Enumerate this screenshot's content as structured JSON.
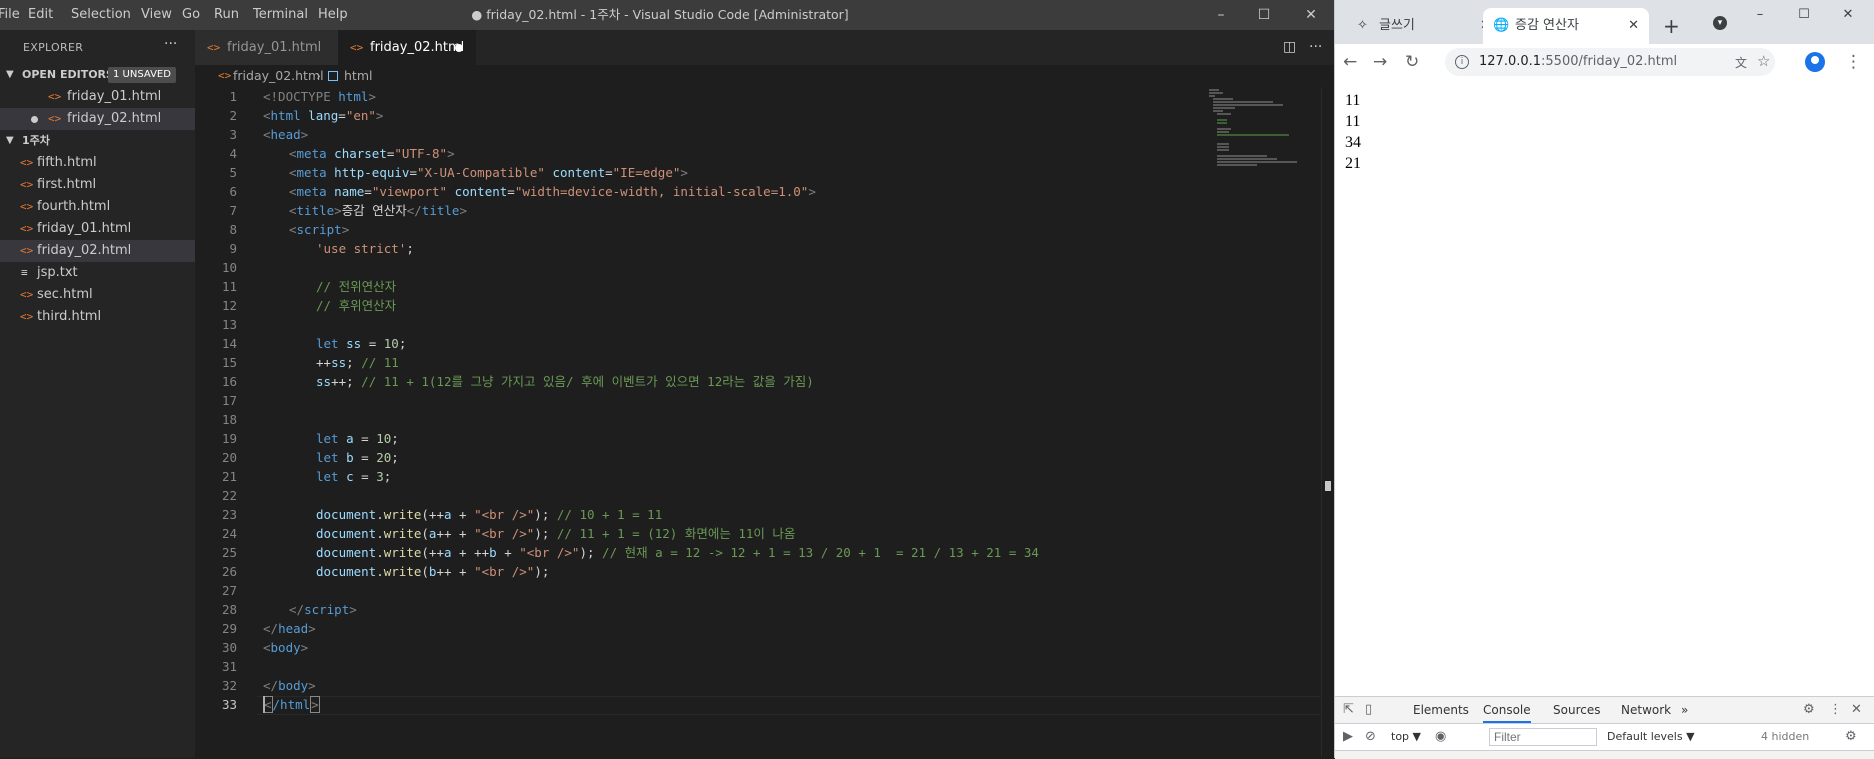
{
  "vscode": {
    "menu": [
      "File",
      "Edit",
      "Selection",
      "View",
      "Go",
      "Run",
      "Terminal",
      "Help"
    ],
    "window_title": "● friday_02.html - 1주차 - Visual Studio Code [Administrator]",
    "explorer_title": "EXPLORER",
    "open_editors": {
      "label": "OPEN EDITORS",
      "badge": "1 UNSAVED",
      "files": [
        "friday_01.html",
        "friday_02.html"
      ]
    },
    "folder": {
      "label": "1주차",
      "files": [
        "fifth.html",
        "first.html",
        "fourth.html",
        "friday_01.html",
        "friday_02.html",
        "jsp.txt",
        "sec.html",
        "third.html"
      ]
    },
    "tabs": [
      "friday_01.html",
      "friday_02.html"
    ],
    "breadcrumb": [
      "friday_02.html",
      "html"
    ],
    "line_numbers": [
      "1",
      "2",
      "3",
      "4",
      "5",
      "6",
      "7",
      "8",
      "9",
      "10",
      "11",
      "12",
      "13",
      "14",
      "15",
      "16",
      "17",
      "18",
      "19",
      "20",
      "21",
      "22",
      "23",
      "24",
      "25",
      "26",
      "27",
      "28",
      "29",
      "30",
      "31",
      "32",
      "33"
    ],
    "code": {
      "l1a": "<!DOCTYPE",
      "l1b": "html",
      "l1c": ">",
      "l2a": "<",
      "l2b": "html",
      "l2c": "lang",
      "l2d": "=",
      "l2e": "\"en\"",
      "l2f": ">",
      "l3a": "<",
      "l3b": "head",
      "l3c": ">",
      "l4a": "<",
      "l4b": "meta",
      "l4c": "charset",
      "l4d": "=",
      "l4e": "\"UTF-8\"",
      "l4f": ">",
      "l5a": "<",
      "l5b": "meta",
      "l5c": "http-equiv",
      "l5d": "=",
      "l5e": "\"X-UA-Compatible\"",
      "l5f": "content",
      "l5g": "\"IE=edge\"",
      "l5h": ">",
      "l6a": "<",
      "l6b": "meta",
      "l6c": "name",
      "l6d": "=",
      "l6e": "\"viewport\"",
      "l6f": "content",
      "l6g": "\"width=device-width, initial-scale=1.0\"",
      "l6h": ">",
      "l7a": "<",
      "l7b": "title",
      "l7c": ">",
      "l7d": "증감 연산자",
      "l7e": "</",
      "l7f": "title",
      "l7g": ">",
      "l8a": "<",
      "l8b": "script",
      "l8c": ">",
      "l9": "'use strict'",
      "l9b": ";",
      "l11": "// 전위연산자",
      "l12": "// 후위연산자",
      "kw_let": "let",
      "l14a": "ss",
      "l14b": " = ",
      "l14c": "10",
      "l14d": ";",
      "l15a": "++",
      "l15b": "ss",
      "l15c": "; ",
      "l15d": "// 11",
      "l16a": "ss",
      "l16b": "++; ",
      "l16c": "// 11 + 1(12를 그냥 가지고 있음/ 후에 이벤트가 있으면 12라는 값을 가짐)",
      "l19a": "a",
      "l19b": " = ",
      "l19c": "10",
      "l19d": ";",
      "l20a": "b",
      "l20b": " = ",
      "l20c": "20",
      "l20d": ";",
      "l21a": "c",
      "l21b": " = ",
      "l21c": "3",
      "l21d": ";",
      "doc": "document",
      "dot": ".",
      "write": "write",
      "br": "\"<br />\"",
      "l23a": "(++",
      "l23b": "a",
      "l23c": " + ",
      "l23d": "); ",
      "l23e": "// 10 + 1 = 11",
      "l24a": "(",
      "l24b": "a",
      "l24c": "++ + ",
      "l24d": "); ",
      "l24e": "// 11 + 1 = (12) 화면에는 11이 나옴",
      "l25a": "(++",
      "l25b": "a",
      "l25c": " + ++",
      "l25d": "b",
      "l25e": " + ",
      "l25f": "); ",
      "l25g": "// 현재 a = 12 -> 12 + 1 = 13 / 20 + 1  = 21 / 13 + 21 = 34",
      "l26a": "(",
      "l26b": "b",
      "l26c": "++ + ",
      "l26d": ");",
      "l28a": "</",
      "l28b": "script",
      "l28c": ">",
      "l29a": "</",
      "l29b": "head",
      "l29c": ">",
      "l30a": "<",
      "l30b": "body",
      "l30c": ">",
      "l32a": "</",
      "l32b": "body",
      "l32c": ">",
      "l33a": "<",
      "l33b": "/html",
      "l33c": ">"
    }
  },
  "browser": {
    "tabs": [
      {
        "title": "글쓰기",
        "close": "✕"
      },
      {
        "title": "증감 연산자",
        "close": "✕"
      }
    ],
    "new_tab": "+",
    "url_host": "127.0.0.1",
    "url_rest": ":5500/friday_02.html",
    "output": [
      "11",
      "11",
      "34",
      "21"
    ],
    "devtools": {
      "tabs": [
        "Elements",
        "Console",
        "Sources",
        "Network"
      ],
      "active_tab": "Console",
      "more": "»",
      "context": "top ▼",
      "filter_placeholder": "Filter",
      "levels": "Default levels ▼",
      "hidden": "4 hidden"
    }
  }
}
